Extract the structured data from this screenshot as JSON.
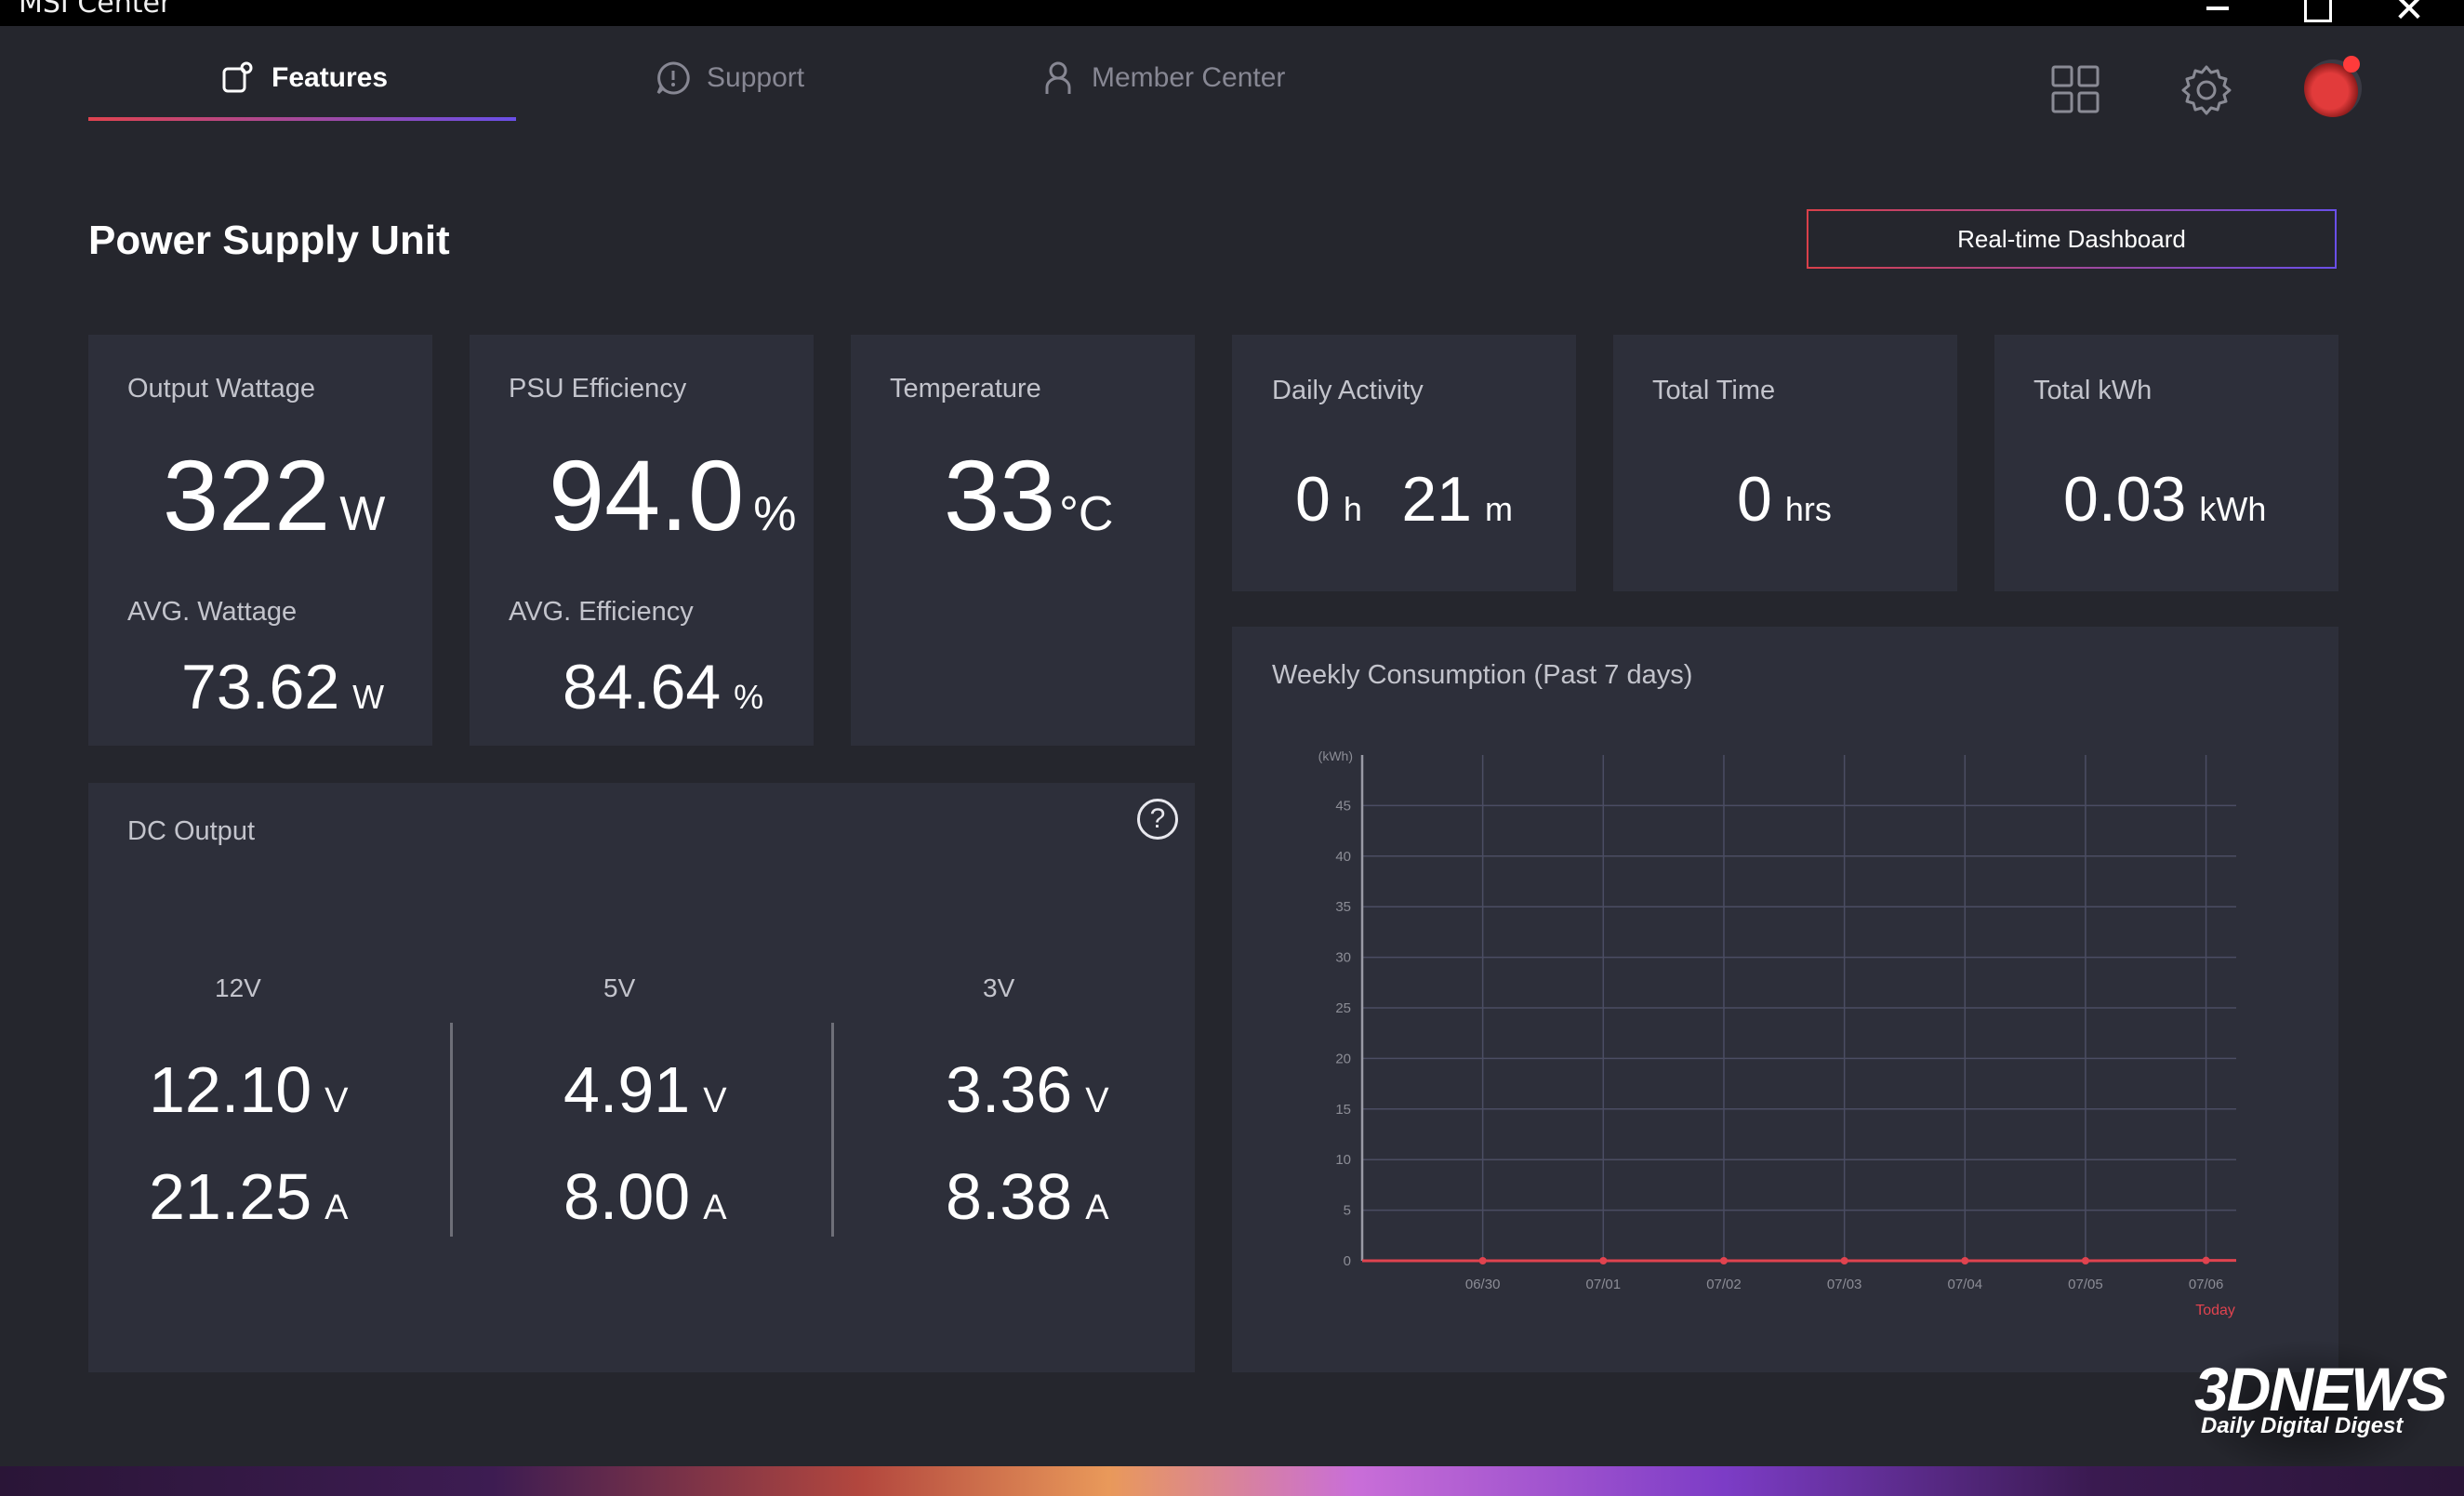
{
  "window": {
    "title": "MSI Center",
    "close_glyph": "✕"
  },
  "nav": {
    "tabs": [
      {
        "label": "Features",
        "icon": "features-icon",
        "active": true
      },
      {
        "label": "Support",
        "icon": "support-icon"
      },
      {
        "label": "Member Center",
        "icon": "member-icon"
      }
    ],
    "accent": "#e0434f",
    "accent_end": "#6a4fe8"
  },
  "page": {
    "title": "Power Supply Unit",
    "dashboard_button": "Real-time Dashboard"
  },
  "cards": {
    "output_wattage": {
      "label": "Output Wattage",
      "value": "322",
      "unit": "W",
      "avg_label": "AVG. Wattage",
      "avg_value": "73.62",
      "avg_unit": "W"
    },
    "psu_efficiency": {
      "label": "PSU Efficiency",
      "value": "94.0",
      "unit": "%",
      "avg_label": "AVG. Efficiency",
      "avg_value": "84.64",
      "avg_unit": "%"
    },
    "temperature": {
      "label": "Temperature",
      "value": "33",
      "unit": "°C"
    },
    "daily_activity": {
      "label": "Daily Activity",
      "hours": "0",
      "hours_unit": "h",
      "minutes": "21",
      "minutes_unit": "m"
    },
    "total_time": {
      "label": "Total Time",
      "value": "0",
      "unit": "hrs"
    },
    "total_kwh": {
      "label": "Total kWh",
      "value": "0.03",
      "unit": "kWh"
    }
  },
  "dc_output": {
    "title": "DC Output",
    "help_glyph": "?",
    "rails": [
      {
        "name": "12V",
        "voltage": "12.10",
        "v_unit": "V",
        "current": "21.25",
        "a_unit": "A"
      },
      {
        "name": "5V",
        "voltage": "4.91",
        "v_unit": "V",
        "current": "8.00",
        "a_unit": "A"
      },
      {
        "name": "3V",
        "voltage": "3.36",
        "v_unit": "V",
        "current": "8.38",
        "a_unit": "A"
      }
    ]
  },
  "weekly": {
    "title": "Weekly Consumption (Past 7 days)"
  },
  "chart_data": {
    "type": "line",
    "ylabel": "(kWh)",
    "categories": [
      "06/30",
      "07/01",
      "07/02",
      "07/03",
      "07/04",
      "07/05",
      "07/06"
    ],
    "values": [
      0,
      0,
      0,
      0,
      0,
      0,
      0.03
    ],
    "ylim": [
      0,
      50
    ],
    "yticks": [
      0,
      5,
      10,
      15,
      20,
      25,
      30,
      35,
      40,
      45
    ],
    "grid": true,
    "highlight_label": "Today",
    "line_color": "#e0434f",
    "grid_color": "#4b4d63"
  },
  "watermark": {
    "logo": "3DNEWS",
    "subtitle": "Daily Digital Digest"
  }
}
